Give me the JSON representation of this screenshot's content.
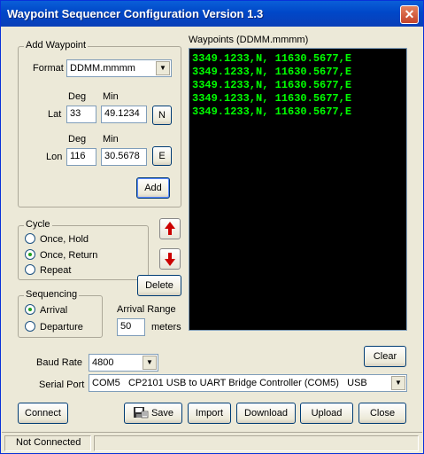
{
  "window": {
    "title": "Waypoint Sequencer Configuration Version 1.3",
    "close_glyph": "✕"
  },
  "add_waypoint": {
    "group_title": "Add Waypoint",
    "format_label": "Format",
    "format_value": "DDMM.mmmm",
    "deg_header": "Deg",
    "min_header": "Min",
    "lat_label": "Lat",
    "lat_deg": "33",
    "lat_min": "49.1234",
    "lat_hemi": "N",
    "lon_label": "Lon",
    "lon_deg": "116",
    "lon_min": "30.5678",
    "lon_hemi": "E",
    "add_label": "Add"
  },
  "waypoints": {
    "title": "Waypoints (DDMM.mmmm)",
    "rows": [
      "3349.1233,N, 11630.5677,E",
      "3349.1233,N, 11630.5677,E",
      "3349.1233,N, 11630.5677,E",
      "3349.1233,N, 11630.5677,E",
      "3349.1233,N, 11630.5677,E"
    ]
  },
  "cycle": {
    "group_title": "Cycle",
    "options": [
      {
        "label": "Once, Hold",
        "selected": false
      },
      {
        "label": "Once, Return",
        "selected": true
      },
      {
        "label": "Repeat",
        "selected": false
      }
    ]
  },
  "sequencing": {
    "group_title": "Sequencing",
    "options": [
      {
        "label": "Arrival",
        "selected": true
      },
      {
        "label": "Departure",
        "selected": false
      }
    ]
  },
  "arrival_range": {
    "label": "Arrival Range",
    "value": "50",
    "unit": "meters"
  },
  "delete_label": "Delete",
  "clear_label": "Clear",
  "baud": {
    "label": "Baud Rate",
    "value": "4800"
  },
  "serial": {
    "label": "Serial Port",
    "value": "COM5   CP2101 USB to UART Bridge Controller (COM5)   USB"
  },
  "buttons": {
    "connect": "Connect",
    "save": "Save",
    "import": "Import",
    "download": "Download",
    "upload": "Upload",
    "close": "Close"
  },
  "status": {
    "text": "Not Connected"
  },
  "colors": {
    "arrow": "#cc0000",
    "list_text": "#00ff00",
    "list_bg": "#000000"
  }
}
